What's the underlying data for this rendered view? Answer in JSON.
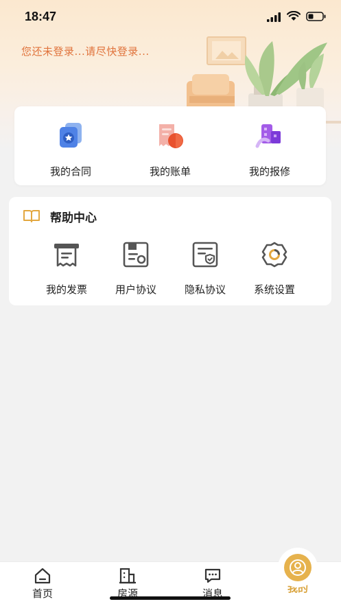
{
  "status": {
    "time": "18:47"
  },
  "header": {
    "login_tip": "您还未登录...请尽快登录..."
  },
  "quick": {
    "items": [
      {
        "label": "我的合同",
        "icon": "contract-icon"
      },
      {
        "label": "我的账单",
        "icon": "bill-icon"
      },
      {
        "label": "我的报修",
        "icon": "repair-icon"
      }
    ]
  },
  "help": {
    "title": "帮助中心",
    "items": [
      {
        "label": "我的发票",
        "icon": "invoice-icon"
      },
      {
        "label": "用户协议",
        "icon": "user-agreement-icon"
      },
      {
        "label": "隐私协议",
        "icon": "privacy-agreement-icon"
      },
      {
        "label": "系统设置",
        "icon": "settings-gear-icon"
      }
    ]
  },
  "tabbar": {
    "tabs": [
      {
        "label": "首页",
        "icon": "home-icon"
      },
      {
        "label": "房源",
        "icon": "building-icon"
      },
      {
        "label": "消息",
        "icon": "message-icon"
      },
      {
        "label": "我的",
        "icon": "user-icon",
        "active": true
      }
    ]
  },
  "colors": {
    "accent": "#e6b24d",
    "login_tip": "#e0733c",
    "active_tab": "#d9a33c"
  }
}
